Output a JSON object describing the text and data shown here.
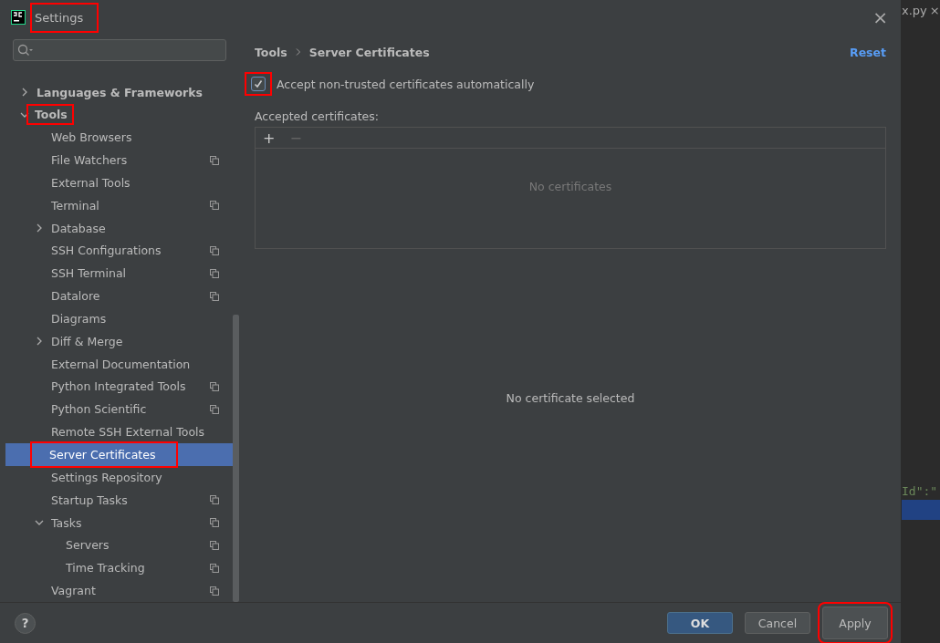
{
  "window": {
    "title": "Settings",
    "highlighted": true,
    "close": "×"
  },
  "editor": {
    "tab": "x.py",
    "tab_close": "×",
    "code": "Id\":\""
  },
  "sidebar": {
    "items": [
      {
        "label": "Languages & Frameworks",
        "bold": true,
        "expanded": false,
        "has_children": true,
        "selected": false,
        "project": false,
        "highlighted": false
      },
      {
        "label": "Tools",
        "bold": true,
        "expanded": true,
        "has_children": true,
        "selected": false,
        "project": false,
        "highlighted": true,
        "children": [
          {
            "label": "Web Browsers",
            "selected": false,
            "project": false,
            "highlighted": false
          },
          {
            "label": "File Watchers",
            "selected": false,
            "project": true,
            "highlighted": false
          },
          {
            "label": "External Tools",
            "selected": false,
            "project": false,
            "highlighted": false
          },
          {
            "label": "Terminal",
            "selected": false,
            "project": true,
            "highlighted": false
          },
          {
            "label": "Database",
            "has_children": true,
            "expanded": false,
            "selected": false,
            "project": false,
            "highlighted": false
          },
          {
            "label": "SSH Configurations",
            "selected": false,
            "project": true,
            "highlighted": false
          },
          {
            "label": "SSH Terminal",
            "selected": false,
            "project": true,
            "highlighted": false
          },
          {
            "label": "Datalore",
            "selected": false,
            "project": true,
            "highlighted": false
          },
          {
            "label": "Diagrams",
            "selected": false,
            "project": false,
            "highlighted": false
          },
          {
            "label": "Diff & Merge",
            "has_children": true,
            "expanded": false,
            "selected": false,
            "project": false,
            "highlighted": false
          },
          {
            "label": "External Documentation",
            "selected": false,
            "project": false,
            "highlighted": false
          },
          {
            "label": "Python Integrated Tools",
            "selected": false,
            "project": true,
            "highlighted": false
          },
          {
            "label": "Python Scientific",
            "selected": false,
            "project": true,
            "highlighted": false
          },
          {
            "label": "Remote SSH External Tools",
            "selected": false,
            "project": false,
            "highlighted": false
          },
          {
            "label": "Server Certificates",
            "selected": true,
            "project": false,
            "highlighted": true
          },
          {
            "label": "Settings Repository",
            "selected": false,
            "project": false,
            "highlighted": false
          },
          {
            "label": "Startup Tasks",
            "selected": false,
            "project": true,
            "highlighted": false
          },
          {
            "label": "Tasks",
            "has_children": true,
            "expanded": true,
            "selected": false,
            "project": true,
            "highlighted": false,
            "children": [
              {
                "label": "Servers",
                "selected": false,
                "project": true,
                "highlighted": false
              },
              {
                "label": "Time Tracking",
                "selected": false,
                "project": true,
                "highlighted": false
              }
            ]
          },
          {
            "label": "Vagrant",
            "selected": false,
            "project": true,
            "highlighted": false
          }
        ]
      }
    ]
  },
  "breadcrumb": [
    "Tools",
    "Server Certificates"
  ],
  "reset": "Reset",
  "accept_checkbox": {
    "label": "Accept non-trusted certificates automatically",
    "checked": true,
    "highlighted": true
  },
  "certificates": {
    "label": "Accepted certificates:",
    "add": "+",
    "remove": "−",
    "empty": "No certificates",
    "detail": "No certificate selected"
  },
  "help": "?",
  "buttons": [
    {
      "label": "OK",
      "kind": "primary",
      "highlighted": false
    },
    {
      "label": "Cancel",
      "kind": "normal",
      "highlighted": false
    },
    {
      "label": "Apply",
      "kind": "normal",
      "highlighted": true
    }
  ]
}
